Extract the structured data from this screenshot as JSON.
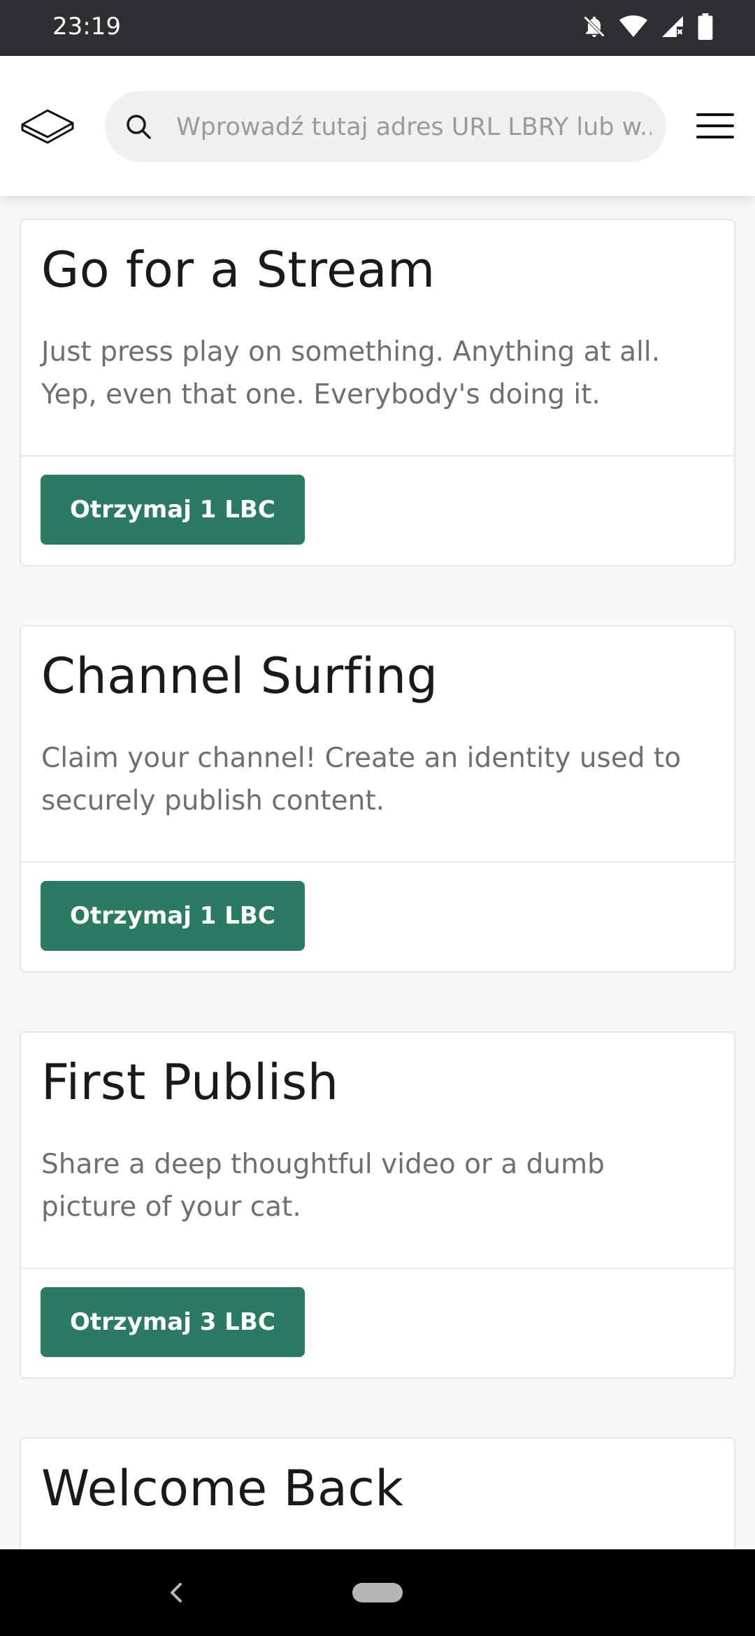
{
  "status_bar": {
    "time": "23:19",
    "icons": [
      "notifications-off-icon",
      "wifi-icon",
      "signal-icon",
      "battery-icon"
    ]
  },
  "header": {
    "logo_icon": "lbry-logo-icon",
    "search": {
      "placeholder": "Wprowadź tutaj adres URL LBRY lub w..."
    },
    "menu_icon": "hamburger-menu-icon"
  },
  "cards": [
    {
      "title": "Go for a Stream",
      "description": "Just press play on something. Anything at all. Yep, even that one. Everybody's doing it.",
      "button_label": "Otrzymaj 1 LBC"
    },
    {
      "title": "Channel Surfing",
      "description": "Claim your channel! Create an identity used to securely publish content.",
      "button_label": "Otrzymaj 1 LBC"
    },
    {
      "title": "First Publish",
      "description": "Share a deep thoughtful video or a dumb picture of your cat.",
      "button_label": "Otrzymaj 3 LBC"
    },
    {
      "title": "Welcome Back"
    }
  ],
  "colors": {
    "accent": "#2b7a64",
    "status_bar": "#2e2f33",
    "background": "#f7f7f7"
  }
}
